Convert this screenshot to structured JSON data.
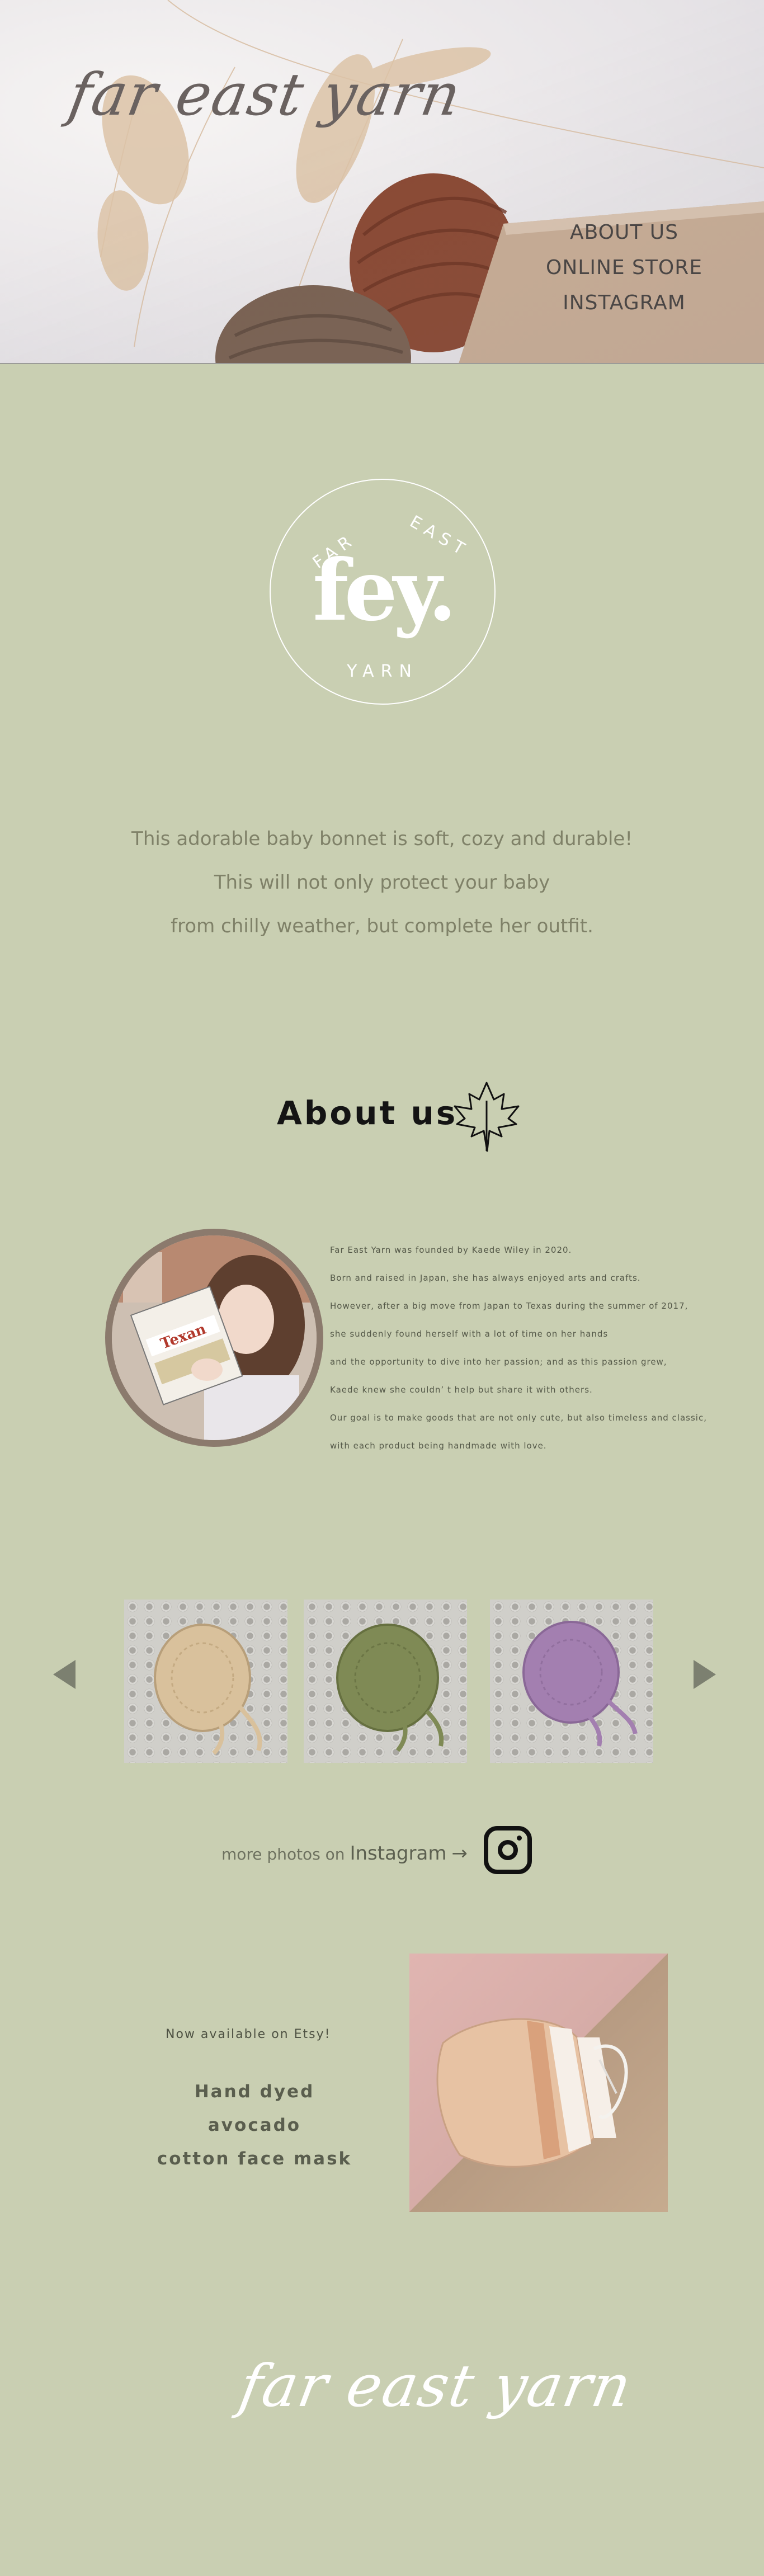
{
  "header": {
    "brand": "far east yarn",
    "nav": [
      {
        "label": "ABOUT US"
      },
      {
        "label": "ONLINE STORE"
      },
      {
        "label": "INSTAGRAM"
      }
    ]
  },
  "logo": {
    "monogram": "fey.",
    "top_left": "FAR",
    "top_right": "EAST",
    "bottom": "YARN"
  },
  "tagline": [
    "This adorable baby bonnet is soft, cozy and durable!",
    "This will not only protect your baby",
    "from chilly weather, but complete her outfit."
  ],
  "about": {
    "title": "About us",
    "paragraphs": [
      "Far East Yarn was founded by Kaede Wiley in 2020.",
      "Born and raised in Japan, she has always enjoyed arts and crafts.",
      "However, after a big move from Japan to Texas during the summer of 2017,",
      "she suddenly found herself with a lot of time on her hands",
      "and the opportunity to dive into her passion; and as this passion grew,",
      "Kaede knew she couldn’ t help but share it with others.",
      "Our goal is to make goods that are not only cute, but also timeless and classic,",
      "with each product being handmade with love."
    ],
    "book_title": "Texan"
  },
  "gallery": {
    "bonnets": [
      {
        "color": "#d9c19c"
      },
      {
        "color": "#7f8a55"
      },
      {
        "color": "#a37fb0"
      }
    ]
  },
  "instagram": {
    "prefix": "more photos on",
    "word": "Instagram",
    "arrow": "→"
  },
  "etsy": {
    "label": "Now available on Etsy!",
    "product_line1": "Hand dyed avocado",
    "product_line2": "cotton face mask"
  },
  "footer": {
    "brand": "far east yarn"
  },
  "colors": {
    "page_bg": "#c9cfb2",
    "nav_text": "#4a4645",
    "tagline_text": "#7f8168",
    "heading": "#141414"
  }
}
